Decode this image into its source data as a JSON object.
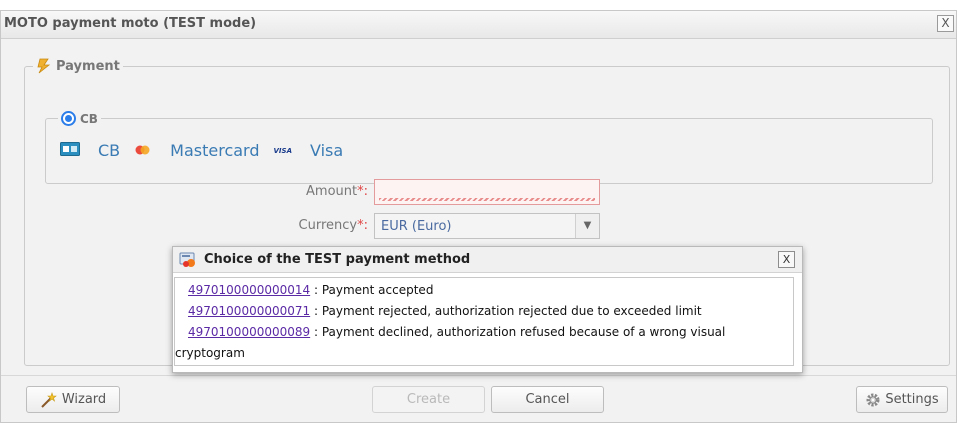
{
  "window": {
    "title": "MOTO payment moto (TEST mode)",
    "close_label": "X"
  },
  "payment": {
    "legend": "Payment",
    "cb_group": {
      "legend": "CB",
      "brands": [
        {
          "icon": "cb-card-icon",
          "label": "CB"
        },
        {
          "icon": "mastercard-icon",
          "label": "Mastercard"
        },
        {
          "icon": "visa-icon",
          "label": "Visa",
          "logo_text": "VISA"
        }
      ]
    },
    "amount": {
      "label": "Amount",
      "required_mark": "*:",
      "value": ""
    },
    "currency": {
      "label": "Currency",
      "required_mark": "*:",
      "value": "EUR (Euro)"
    }
  },
  "popup": {
    "title": "Choice of the TEST payment method",
    "close_label": "X",
    "options": [
      {
        "card": "4970100000000014",
        "text": " : Payment accepted"
      },
      {
        "card": "4970100000000071",
        "text": " : Payment rejected, authorization rejected due to exceeded limit"
      },
      {
        "card": "4970100000000089",
        "text": " : Payment declined, authorization refused because of a wrong visual"
      }
    ],
    "continuation": "cryptogram"
  },
  "buttons": {
    "wizard": "Wizard",
    "create": "Create",
    "cancel": "Cancel",
    "settings": "Settings"
  },
  "colors": {
    "link": "#5b2aa5",
    "brand_text": "#3a7bb4",
    "radio": "#2b7de9",
    "required": "#e04545"
  }
}
